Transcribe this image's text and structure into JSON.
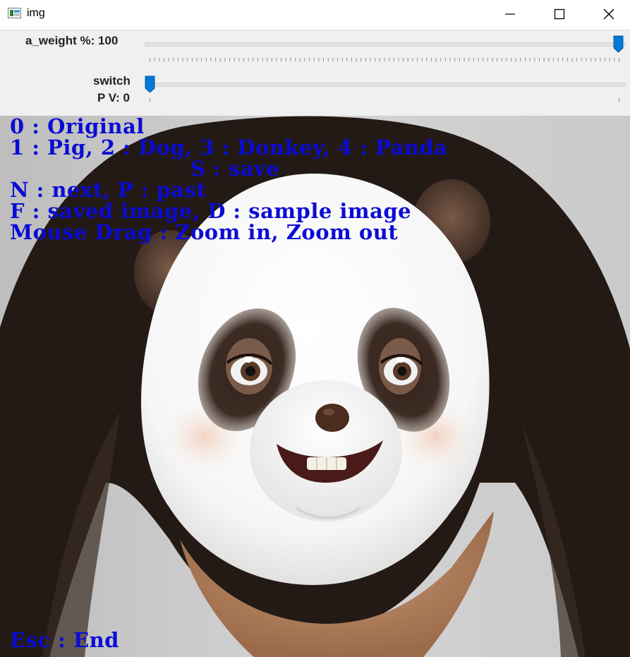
{
  "window": {
    "title": "img"
  },
  "trackbars": [
    {
      "label": "a_weight %: 100",
      "value": 100,
      "max": 100
    },
    {
      "label_line1": "switch",
      "label_line2": "P V: 0",
      "value": 0,
      "max": 1
    }
  ],
  "overlay": {
    "line1": "0 : Original",
    "line2": "1 : Pig, 2 : Dog, 3 : Donkey, 4 : Panda",
    "line3": "S : save",
    "line4": "N : next, P : past",
    "line5": "F : saved image, D : sample image",
    "line6": "Mouse Drag : Zoom in, Zoom out",
    "footer": "Esc : End"
  },
  "colors": {
    "overlay_text": "#0b0bd6",
    "slider_thumb": "#0078d7",
    "panda_patch": "#3a2a22",
    "mask_white": "#fafafa"
  },
  "icons": [
    "app-icon",
    "minimize-icon",
    "maximize-icon",
    "close-icon"
  ]
}
